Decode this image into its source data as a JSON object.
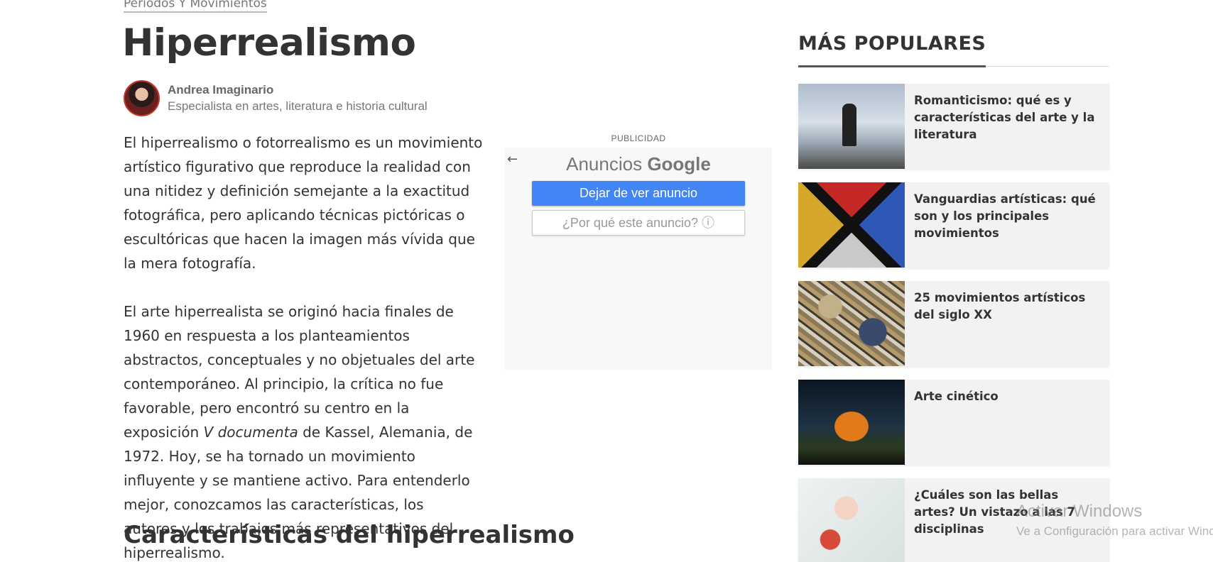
{
  "breadcrumb": "Periodos Y Movimientos",
  "title": "Hiperrealismo",
  "author": {
    "name": "Andrea Imaginario",
    "description": "Especialista en artes, literatura e historia cultural"
  },
  "article": {
    "p1": "El hiperrealismo o fotorrealismo es un movimiento artístico figurativo que reproduce la realidad con una nitidez y definición semejante a la exactitud fotográfica, pero aplicando técnicas pictóricas o escultóricas que hacen la imagen más vívida que la mera fotografía.",
    "p2a": "El arte hiperrealista se originó hacia finales de 1960 en respuesta a los planteamientos abstractos, conceptuales y no objetuales del arte contemporáneo. Al principio, la crítica no fue favorable, pero encontró su centro en la exposición ",
    "p2_italic": "V documenta",
    "p2b": " de Kassel, Alemania, de 1972. Hoy, se ha tornado un movimiento influyente y se mantiene activo. Para entenderlo mejor, conozcamos las características, los autores y los trabajos más representativos del hiperrealismo."
  },
  "ad": {
    "label": "PUBLICIDAD",
    "back_icon": "arrow-left-icon",
    "title_prefix": "Anuncios",
    "title_brand": "Google",
    "stop_button": "Dejar de ver anuncio",
    "why_button": "¿Por qué este anuncio? ⓘ"
  },
  "section_heading": "Características del hiperrealismo",
  "sidebar": {
    "heading": "MÁS POPULARES",
    "items": [
      {
        "title": "Romanticismo: qué es y características del arte y la literatura"
      },
      {
        "title": "Vanguardias artísticas: qué son y los principales movimientos"
      },
      {
        "title": "25 movimientos artísticos del siglo XX"
      },
      {
        "title": "Arte cinético"
      },
      {
        "title": "¿Cuáles son las bellas artes? Un vistazo a las 7 disciplinas"
      }
    ]
  },
  "watermark": {
    "line1": "Activar Windows",
    "line2": "Ve a Configuración para activar Windows."
  },
  "colors": {
    "ad_button": "#4285f4",
    "avatar_border": "#c0392b"
  }
}
